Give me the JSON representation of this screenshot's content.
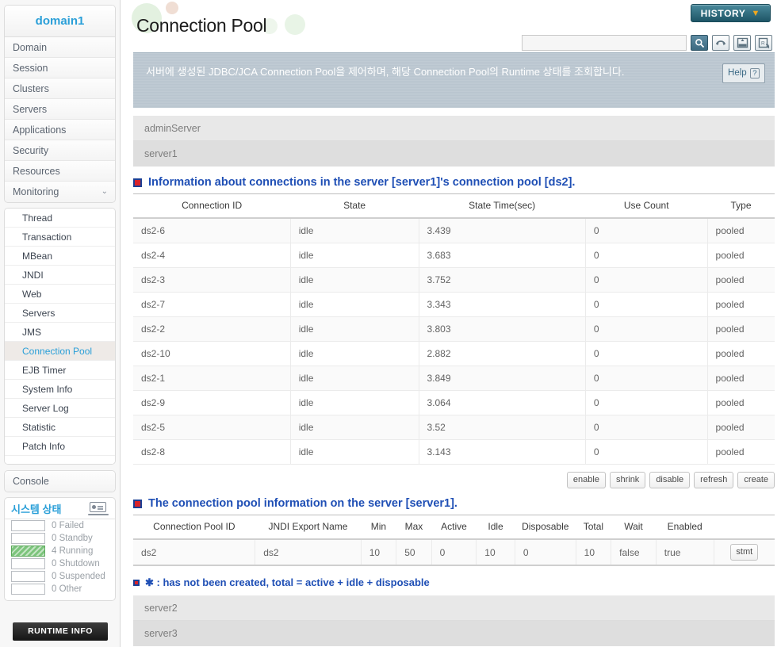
{
  "sidebar": {
    "domain_title": "domain1",
    "nav": [
      {
        "label": "Domain",
        "chevron": ""
      },
      {
        "label": "Session",
        "chevron": ""
      },
      {
        "label": "Clusters",
        "chevron": ""
      },
      {
        "label": "Servers",
        "chevron": ""
      },
      {
        "label": "Applications",
        "chevron": ""
      },
      {
        "label": "Security",
        "chevron": ""
      },
      {
        "label": "Resources",
        "chevron": ""
      },
      {
        "label": "Monitoring",
        "chevron": "⌄"
      }
    ],
    "submenu": [
      {
        "label": "Thread",
        "active": false
      },
      {
        "label": "Transaction",
        "active": false
      },
      {
        "label": "MBean",
        "active": false
      },
      {
        "label": "JNDI",
        "active": false
      },
      {
        "label": "Web",
        "active": false
      },
      {
        "label": "Servers",
        "active": false
      },
      {
        "label": "JMS",
        "active": false
      },
      {
        "label": "Connection Pool",
        "active": true
      },
      {
        "label": "EJB Timer",
        "active": false
      },
      {
        "label": "System Info",
        "active": false
      },
      {
        "label": "Server Log",
        "active": false
      },
      {
        "label": "Statistic",
        "active": false
      },
      {
        "label": "Patch Info",
        "active": false
      }
    ],
    "console_label": "Console",
    "system_status": {
      "title": "시스템 상태",
      "icon": "laptop-icon",
      "rows": [
        {
          "count": "0",
          "label": "Failed",
          "filled": false
        },
        {
          "count": "0",
          "label": "Standby",
          "filled": false
        },
        {
          "count": "4",
          "label": "Running",
          "filled": true
        },
        {
          "count": "0",
          "label": "Shutdown",
          "filled": false
        },
        {
          "count": "0",
          "label": "Suspended",
          "filled": false
        },
        {
          "count": "0",
          "label": "Other",
          "filled": false
        }
      ]
    },
    "runtime_info_label": "RUNTIME INFO"
  },
  "header": {
    "page_title": "Connection Pool",
    "history_label": "HISTORY",
    "history_chevron": "▼",
    "search": {
      "value": "",
      "placeholder": ""
    },
    "toolbar_icons": [
      {
        "name": "search-icon",
        "glyph": "⚲"
      },
      {
        "name": "refresh-loop-icon",
        "glyph": "⟳"
      },
      {
        "name": "export-xml-icon",
        "glyph": "XML"
      },
      {
        "name": "export-report-icon",
        "glyph": "R"
      }
    ]
  },
  "notice": {
    "text": "서버에 생성된 JDBC/JCA Connection Pool을 제어하며, 해당 Connection Pool의 Runtime 상태를 조회합니다.",
    "help_label": "Help",
    "help_mark": "?"
  },
  "server_list_top": [
    {
      "name": "adminServer"
    },
    {
      "name": "server1"
    }
  ],
  "server_list_bottom": [
    {
      "name": "server2"
    },
    {
      "name": "server3"
    }
  ],
  "connections_section": {
    "title": "Information about connections in the server [server1]'s connection pool [ds2].",
    "columns": [
      "Connection ID",
      "State",
      "State Time(sec)",
      "Use Count",
      "Type"
    ],
    "rows": [
      [
        "ds2-6",
        "idle",
        "3.439",
        "0",
        "pooled"
      ],
      [
        "ds2-4",
        "idle",
        "3.683",
        "0",
        "pooled"
      ],
      [
        "ds2-3",
        "idle",
        "3.752",
        "0",
        "pooled"
      ],
      [
        "ds2-7",
        "idle",
        "3.343",
        "0",
        "pooled"
      ],
      [
        "ds2-2",
        "idle",
        "3.803",
        "0",
        "pooled"
      ],
      [
        "ds2-10",
        "idle",
        "2.882",
        "0",
        "pooled"
      ],
      [
        "ds2-1",
        "idle",
        "3.849",
        "0",
        "pooled"
      ],
      [
        "ds2-9",
        "idle",
        "3.064",
        "0",
        "pooled"
      ],
      [
        "ds2-5",
        "idle",
        "3.52",
        "0",
        "pooled"
      ],
      [
        "ds2-8",
        "idle",
        "3.143",
        "0",
        "pooled"
      ]
    ],
    "buttons": [
      "enable",
      "shrink",
      "disable",
      "refresh",
      "create"
    ]
  },
  "pool_section": {
    "title": "The connection pool information on the server [server1].",
    "columns": [
      "Connection Pool ID",
      "JNDI Export Name",
      "Min",
      "Max",
      "Active",
      "Idle",
      "Disposable",
      "Total",
      "Wait",
      "Enabled",
      ""
    ],
    "rows": [
      [
        "ds2",
        "ds2",
        "10",
        "50",
        "0",
        "10",
        "0",
        "10",
        "false",
        "true"
      ]
    ],
    "row_action_label": "stmt"
  },
  "footnote": {
    "text": "✱ : has not been created, total = active + idle + disposable"
  },
  "colors": {
    "accent_blue": "#1f4fb5",
    "link_blue": "#2a9fd8",
    "history_teal": "#1e5566",
    "history_chevron_orange": "#f0a71e",
    "notice_bg": "#b9c5cf",
    "running_green": "#7cc47c",
    "marker_red": "#d8232a"
  }
}
